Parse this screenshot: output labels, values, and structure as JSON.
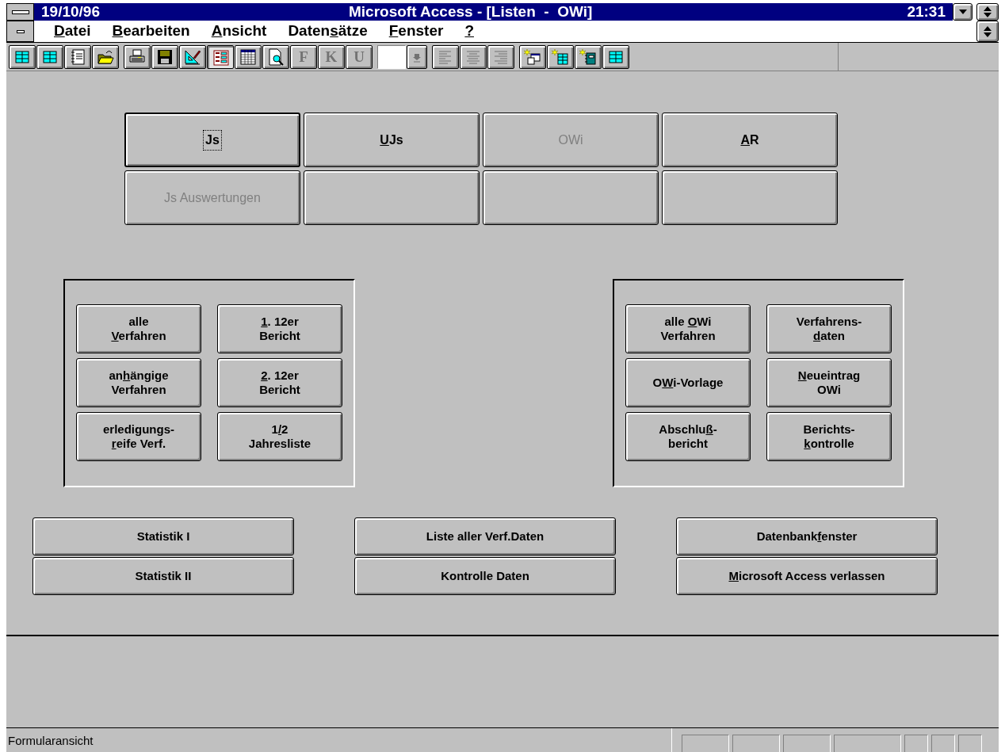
{
  "title_bar": {
    "date": "19/10/96",
    "title": "Microsoft Access - [Listen  -  OWi]",
    "clock": "21:31"
  },
  "menu": [
    {
      "key": "D",
      "post": "atei"
    },
    {
      "key": "B",
      "post": "earbeiten"
    },
    {
      "key": "A",
      "post": "nsicht"
    },
    {
      "pre": "Daten",
      "key": "s",
      "post": "ätze"
    },
    {
      "key": "F",
      "post": "enster"
    },
    {
      "key": "?"
    }
  ],
  "toolbar": [
    [
      {
        "kind": "table",
        "pressed": false,
        "disabled": false
      },
      {
        "kind": "table",
        "pressed": false,
        "disabled": false
      },
      {
        "kind": "notebook",
        "pressed": false,
        "disabled": false
      },
      {
        "kind": "folder",
        "pressed": false,
        "disabled": false
      }
    ],
    [
      {
        "kind": "printer",
        "pressed": false,
        "disabled": false
      },
      {
        "kind": "floppy",
        "pressed": false,
        "disabled": false
      },
      {
        "kind": "ruler",
        "pressed": false,
        "disabled": false
      },
      {
        "kind": "form",
        "pressed": true,
        "disabled": false
      },
      {
        "kind": "grid",
        "pressed": false,
        "disabled": false
      },
      {
        "kind": "preview",
        "pressed": false,
        "disabled": false
      },
      {
        "kind": "letter",
        "label": "F",
        "pressed": false,
        "disabled": true
      },
      {
        "kind": "letter",
        "label": "K",
        "pressed": false,
        "disabled": true
      },
      {
        "kind": "letter",
        "label": "U",
        "pressed": false,
        "disabled": true
      }
    ],
    [
      {
        "kind": "color"
      },
      {
        "kind": "dropdown",
        "pressed": false,
        "disabled": true
      }
    ],
    [
      {
        "kind": "align-left",
        "pressed": false,
        "disabled": true
      },
      {
        "kind": "align-center",
        "pressed": false,
        "disabled": true
      },
      {
        "kind": "align-right",
        "pressed": false,
        "disabled": true
      }
    ],
    [
      {
        "kind": "new-form",
        "pressed": false,
        "disabled": false
      },
      {
        "kind": "new-table",
        "pressed": false,
        "disabled": false
      },
      {
        "kind": "new-notebook",
        "pressed": false,
        "disabled": false
      },
      {
        "kind": "table",
        "pressed": false,
        "disabled": false
      }
    ]
  ],
  "section_buttons": [
    {
      "label": "Js",
      "focused": true,
      "disabled": false
    },
    {
      "key": "U",
      "post": "Js",
      "focused": false,
      "disabled": false
    },
    {
      "label": "OWi",
      "focused": false,
      "disabled": true
    },
    {
      "key": "A",
      "post": "R",
      "focused": false,
      "disabled": false
    },
    {
      "label": "Js Auswertungen",
      "focused": false,
      "disabled": true
    },
    {
      "focused": false
    },
    {
      "focused": false
    },
    {
      "focused": false
    }
  ],
  "left_panel": [
    {
      "lines": [
        {
          "text": "alle"
        },
        {
          "key": "V",
          "post": "erfahren"
        }
      ]
    },
    {
      "lines": [
        {
          "key": "1",
          "post": ". 12er"
        },
        {
          "text": "Bericht"
        }
      ]
    },
    {
      "lines": [
        {
          "pre": "an",
          "key": "h",
          "post": "ängige"
        },
        {
          "text": "Verfahren"
        }
      ]
    },
    {
      "lines": [
        {
          "key": "2",
          "post": ". 12er"
        },
        {
          "text": "Bericht"
        }
      ]
    },
    {
      "lines": [
        {
          "text": "erledigungs-"
        },
        {
          "key": "r",
          "post": "eife Verf."
        }
      ]
    },
    {
      "lines": [
        {
          "pre": "1",
          "key": "/",
          "post": "2"
        },
        {
          "text": "Jahresliste"
        }
      ]
    }
  ],
  "right_panel": [
    {
      "lines": [
        {
          "pre": "alle ",
          "key": "O",
          "post": "Wi"
        },
        {
          "text": "Verfahren"
        }
      ]
    },
    {
      "lines": [
        {
          "text": "Verfahrens-"
        },
        {
          "key": "d",
          "post": "aten"
        }
      ]
    },
    {
      "lines": [
        {
          "pre": "O",
          "key": "W",
          "post": "i-Vorlage"
        }
      ]
    },
    {
      "lines": [
        {
          "key": "N",
          "post": "eueintrag"
        },
        {
          "text": "OWi"
        }
      ]
    },
    {
      "lines": [
        {
          "pre": "Abschlu",
          "key": "ß",
          "post": "-"
        },
        {
          "text": "bericht"
        }
      ]
    },
    {
      "lines": [
        {
          "text": "Berichts-"
        },
        {
          "key": "k",
          "post": "ontrolle"
        }
      ]
    }
  ],
  "bottom_buttons": [
    {
      "label": "Statistik I"
    },
    {
      "label": "Liste aller Verf.Daten"
    },
    {
      "pre": "Datenbank",
      "key": "f",
      "post": "enster"
    },
    {
      "label": "Statistik II"
    },
    {
      "label": "Kontrolle Daten"
    },
    {
      "key": "M",
      "post": "icrosoft Access verlassen"
    }
  ],
  "status_bar": {
    "text": "Formularansicht"
  }
}
